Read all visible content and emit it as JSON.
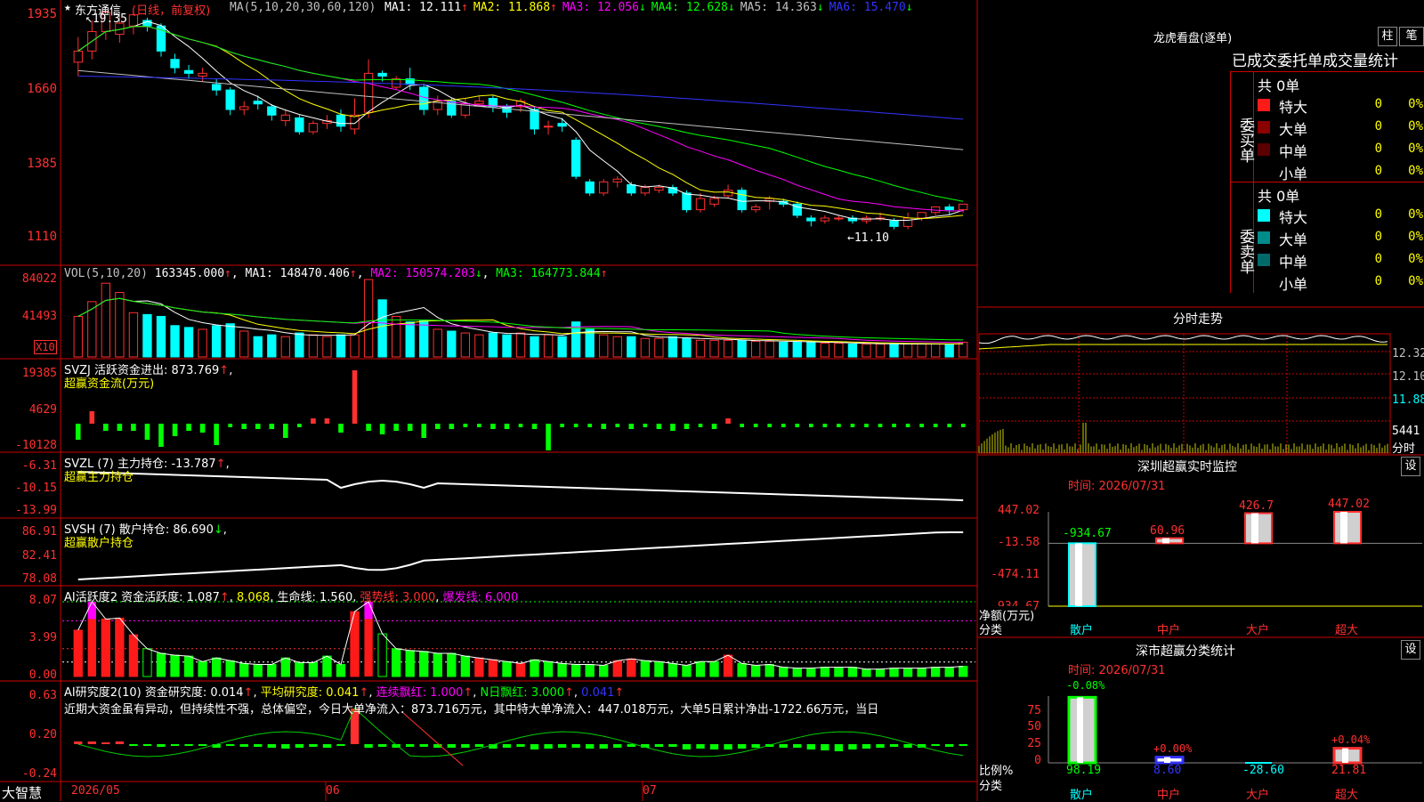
{
  "header": {
    "stock_mark": "★",
    "stock_name": "东方通信",
    "period_label": "(日线，前复权)",
    "ma_label": "MA(5,10,20,30,60,120)",
    "ma_values": [
      {
        "label": "MA1:",
        "value": "12.111",
        "arrow": "↑",
        "color": "#ffffff"
      },
      {
        "label": "MA2:",
        "value": "11.868",
        "arrow": "↑",
        "color": "#ffff00"
      },
      {
        "label": "MA3:",
        "value": "12.056",
        "arrow": "↓",
        "color": "#ff00ff"
      },
      {
        "label": "MA4:",
        "value": "12.628",
        "arrow": "↓",
        "color": "#00ff00"
      },
      {
        "label": "MA5:",
        "value": "14.363",
        "arrow": "↓",
        "color": "#c0c0c0"
      },
      {
        "label": "MA6:",
        "value": "15.470",
        "arrow": "↓",
        "color": "#3333ff"
      }
    ],
    "max_marker": "19.35",
    "min_marker": "11.10"
  },
  "price_axis": [
    "1935",
    "1660",
    "1385",
    "1110"
  ],
  "vol_panel": {
    "title": "VOL(5,10,20)",
    "value": "163345.000",
    "ma1": "MA1: 148470.406",
    "ma1_arrow": "↑",
    "ma2": "MA2: 150574.203",
    "ma2_arrow": "↓",
    "ma3": "MA3: 164773.844",
    "ma3_arrow": "↑",
    "axis": [
      "84022",
      "41493"
    ],
    "unit": "X10"
  },
  "svzj_panel": {
    "title": "SVZJ  活跃资金进出: 873.769",
    "arrow": "↑",
    "subtitle": "超赢资金流(万元)",
    "axis": [
      "19385",
      "4629",
      "-10128"
    ]
  },
  "svzl_panel": {
    "title": "SVZL (7) 主力持仓: -13.787",
    "arrow": "↑",
    "subtitle": "超赢主力持仓",
    "axis": [
      "-6.31",
      "-10.15",
      "-13.99"
    ]
  },
  "svsh_panel": {
    "title": "SVSH (7) 散户持仓: 86.690",
    "arrow": "↓",
    "subtitle": "超赢散户持仓",
    "axis": [
      "86.91",
      "82.41",
      "78.08"
    ]
  },
  "ai_active_panel": {
    "title": "AI活跃度2 资金活跃度: 1.087",
    "arrow1": "↑",
    "v2": "8.068",
    "life": "生命线: 1.560",
    "strong": "强势线: 3.000",
    "burst": "爆发线: 6.000",
    "axis": [
      "8.07",
      "3.99",
      "0.00"
    ]
  },
  "ai_research_panel": {
    "title": "AI研究度2(10) 资金研究度: 0.014",
    "arrow1": "↑",
    "avg": "平均研究度: 0.041",
    "arrow2": "↑",
    "red": "连续飘红: 1.000",
    "arrow3": "↑",
    "nred": "N日飘红: 3.000",
    "arrow4": "↑",
    "last": "0.041",
    "arrow5": "↑",
    "comment": "近期大资金虽有异动，但持续性不强，总体偏空，今日大单净流入：873.716万元，其中特大单净流入：447.018万元，大单5日累计净出-1722.66万元，当日",
    "axis": [
      "0.63",
      "0.20",
      "-0.24"
    ]
  },
  "date_axis": [
    "2026/05",
    "06",
    "07"
  ],
  "brand": "大智慧",
  "right_panel": {
    "lhb_title": "龙虎看盘(逐单)",
    "btn_bar": "柱",
    "btn_stroke": "笔",
    "stats_title": "已成交委托单成交量统计",
    "buy_label": "委买单",
    "sell_label": "委卖单",
    "buy_total": "共 0单",
    "sell_total": "共 0单",
    "rows": [
      {
        "name": "特大",
        "count": "0",
        "pct": "0%"
      },
      {
        "name": "大单",
        "count": "0",
        "pct": "0%"
      },
      {
        "name": "中单",
        "count": "0",
        "pct": "0%"
      },
      {
        "name": "小单",
        "count": "0",
        "pct": "0%"
      }
    ],
    "sell_rows": [
      {
        "name": "特大",
        "count": "0",
        "pct": "0%"
      },
      {
        "name": "大单",
        "count": "0",
        "pct": "0%"
      },
      {
        "name": "中单",
        "count": "0",
        "pct": "0%"
      },
      {
        "name": "小单",
        "count": "0",
        "pct": "0%"
      }
    ],
    "intraday_title": "分时走势",
    "intraday_axis": [
      "12.32",
      "12.10",
      "11.88"
    ],
    "intraday_vol": "5441",
    "intraday_unit": "分时",
    "monitor_title": "深圳超赢实时监控",
    "monitor_btn": "设",
    "monitor_time": "时间: 2026/07/31",
    "monitor_axis": [
      "447.02",
      "-13.58",
      "-474.11",
      "-934.67"
    ],
    "monitor_ylabel": "净额(万元)",
    "monitor_xlabel": "分类",
    "monitor_cats": [
      "散户",
      "中户",
      "大户",
      "超大"
    ],
    "monitor_values": [
      -934.67,
      60.96,
      426.7,
      447.02
    ],
    "monitor_value_labels": [
      "-934.67",
      "60.96",
      "426.7",
      "447.02"
    ],
    "class_title": "深市超赢分类统计",
    "class_btn": "设",
    "class_time": "时间: 2026/07/31",
    "class_axis": [
      "75",
      "50",
      "25",
      "0"
    ],
    "class_ylabel": "比例%",
    "class_xlabel": "分类",
    "class_top_labels": [
      "-0.08%",
      "+0.00%",
      "",
      "+0.04%"
    ],
    "class_bottom_labels": [
      "98.19",
      "8.60",
      "-28.60",
      "21.81"
    ],
    "class_values": [
      98.19,
      8.6,
      -28.6,
      21.81
    ]
  },
  "chart_data": [
    {
      "type": "candlestick",
      "title": "东方通信 (日线，前复权)",
      "ylim": [
        11.1,
        19.35
      ],
      "candles": [
        [
          17.5,
          17.9,
          17.0,
          18.4
        ],
        [
          17.9,
          18.6,
          17.6,
          19.0
        ],
        [
          18.6,
          19.3,
          18.3,
          19.35
        ],
        [
          18.5,
          18.9,
          18.2,
          19.2
        ],
        [
          18.8,
          19.2,
          18.5,
          19.3
        ],
        [
          19.0,
          18.8,
          18.6,
          19.1
        ],
        [
          18.8,
          17.9,
          17.7,
          18.9
        ],
        [
          17.6,
          17.3,
          17.1,
          17.8
        ],
        [
          17.2,
          17.1,
          16.9,
          17.4
        ],
        [
          17.0,
          17.1,
          16.8,
          17.3
        ],
        [
          16.7,
          16.5,
          16.3,
          16.9
        ],
        [
          16.5,
          15.8,
          15.6,
          16.6
        ],
        [
          15.8,
          15.9,
          15.6,
          16.1
        ],
        [
          16.1,
          16.0,
          15.8,
          16.3
        ],
        [
          15.9,
          15.6,
          15.4,
          16.0
        ],
        [
          15.4,
          15.6,
          15.2,
          15.8
        ],
        [
          15.5,
          15.0,
          14.9,
          15.6
        ],
        [
          15.0,
          15.3,
          14.9,
          15.4
        ],
        [
          15.3,
          15.4,
          15.1,
          15.6
        ],
        [
          15.6,
          15.2,
          15.0,
          15.8
        ],
        [
          15.1,
          15.6,
          14.9,
          16.2
        ],
        [
          15.7,
          17.1,
          15.5,
          17.6
        ],
        [
          17.1,
          17.0,
          16.8,
          17.2
        ],
        [
          16.6,
          16.9,
          16.5,
          17.0
        ],
        [
          16.9,
          16.7,
          16.5,
          17.3
        ],
        [
          16.6,
          15.8,
          15.6,
          16.7
        ],
        [
          15.8,
          16.1,
          15.6,
          16.3
        ],
        [
          16.1,
          15.6,
          15.5,
          16.2
        ],
        [
          15.6,
          16.0,
          15.5,
          16.2
        ],
        [
          16.0,
          16.1,
          15.9,
          16.3
        ],
        [
          16.2,
          15.9,
          15.7,
          16.3
        ],
        [
          15.9,
          15.7,
          15.5,
          16.0
        ],
        [
          15.9,
          16.1,
          15.7,
          16.2
        ],
        [
          15.8,
          15.1,
          14.9,
          15.9
        ],
        [
          15.2,
          15.2,
          14.9,
          15.4
        ],
        [
          15.3,
          15.2,
          15.0,
          15.5
        ],
        [
          14.7,
          13.4,
          13.3,
          14.8
        ],
        [
          13.2,
          12.8,
          12.7,
          13.3
        ],
        [
          12.8,
          13.2,
          12.7,
          13.3
        ],
        [
          13.2,
          13.3,
          13.0,
          13.4
        ],
        [
          13.1,
          12.8,
          12.7,
          13.2
        ],
        [
          12.8,
          13.0,
          12.7,
          13.1
        ],
        [
          12.9,
          13.0,
          12.8,
          13.1
        ],
        [
          13.0,
          12.8,
          12.7,
          13.1
        ],
        [
          12.8,
          12.2,
          12.1,
          12.9
        ],
        [
          12.2,
          12.6,
          12.1,
          12.8
        ],
        [
          12.4,
          12.6,
          12.3,
          12.7
        ],
        [
          12.7,
          12.9,
          12.6,
          13.1
        ],
        [
          12.9,
          12.2,
          12.1,
          13.0
        ],
        [
          12.2,
          12.3,
          12.1,
          12.4
        ],
        [
          12.5,
          12.6,
          12.2,
          12.7
        ],
        [
          12.5,
          12.4,
          12.3,
          12.6
        ],
        [
          12.4,
          12.0,
          11.9,
          12.5
        ],
        [
          11.9,
          11.8,
          11.6,
          12.0
        ],
        [
          11.8,
          11.9,
          11.7,
          12.0
        ],
        [
          11.9,
          11.9,
          11.8,
          12.0
        ],
        [
          11.9,
          11.8,
          11.7,
          12.0
        ],
        [
          11.8,
          11.9,
          11.7,
          12.0
        ],
        [
          11.9,
          11.9,
          11.8,
          12.1
        ],
        [
          11.8,
          11.6,
          11.5,
          11.9
        ],
        [
          11.6,
          11.9,
          11.5,
          12.1
        ],
        [
          11.9,
          12.1,
          11.8,
          12.1
        ],
        [
          12.1,
          12.3,
          12.0,
          12.3
        ],
        [
          12.3,
          12.2,
          12.0,
          12.4
        ],
        [
          12.2,
          12.4,
          12.1,
          12.4
        ]
      ]
    },
    {
      "type": "bar",
      "title": "VOL(5,10,20)",
      "ylim": [
        0,
        84022
      ],
      "values": [
        44000,
        60000,
        80000,
        70000,
        48000,
        46000,
        44000,
        34000,
        32000,
        30000,
        34000,
        36000,
        28000,
        22000,
        24000,
        22000,
        26000,
        24000,
        22000,
        24000,
        24000,
        84000,
        62000,
        44000,
        38000,
        40000,
        30000,
        28000,
        26000,
        24000,
        26000,
        24000,
        26000,
        22000,
        24000,
        22000,
        38000,
        30000,
        24000,
        22000,
        22000,
        20000,
        20000,
        22000,
        20000,
        18000,
        18000,
        18000,
        18000,
        17000,
        17000,
        16000,
        16000,
        16000,
        15000,
        15000,
        14000,
        14000,
        14000,
        14000,
        14000,
        14000,
        14000,
        14000,
        16000
      ]
    }
  ]
}
